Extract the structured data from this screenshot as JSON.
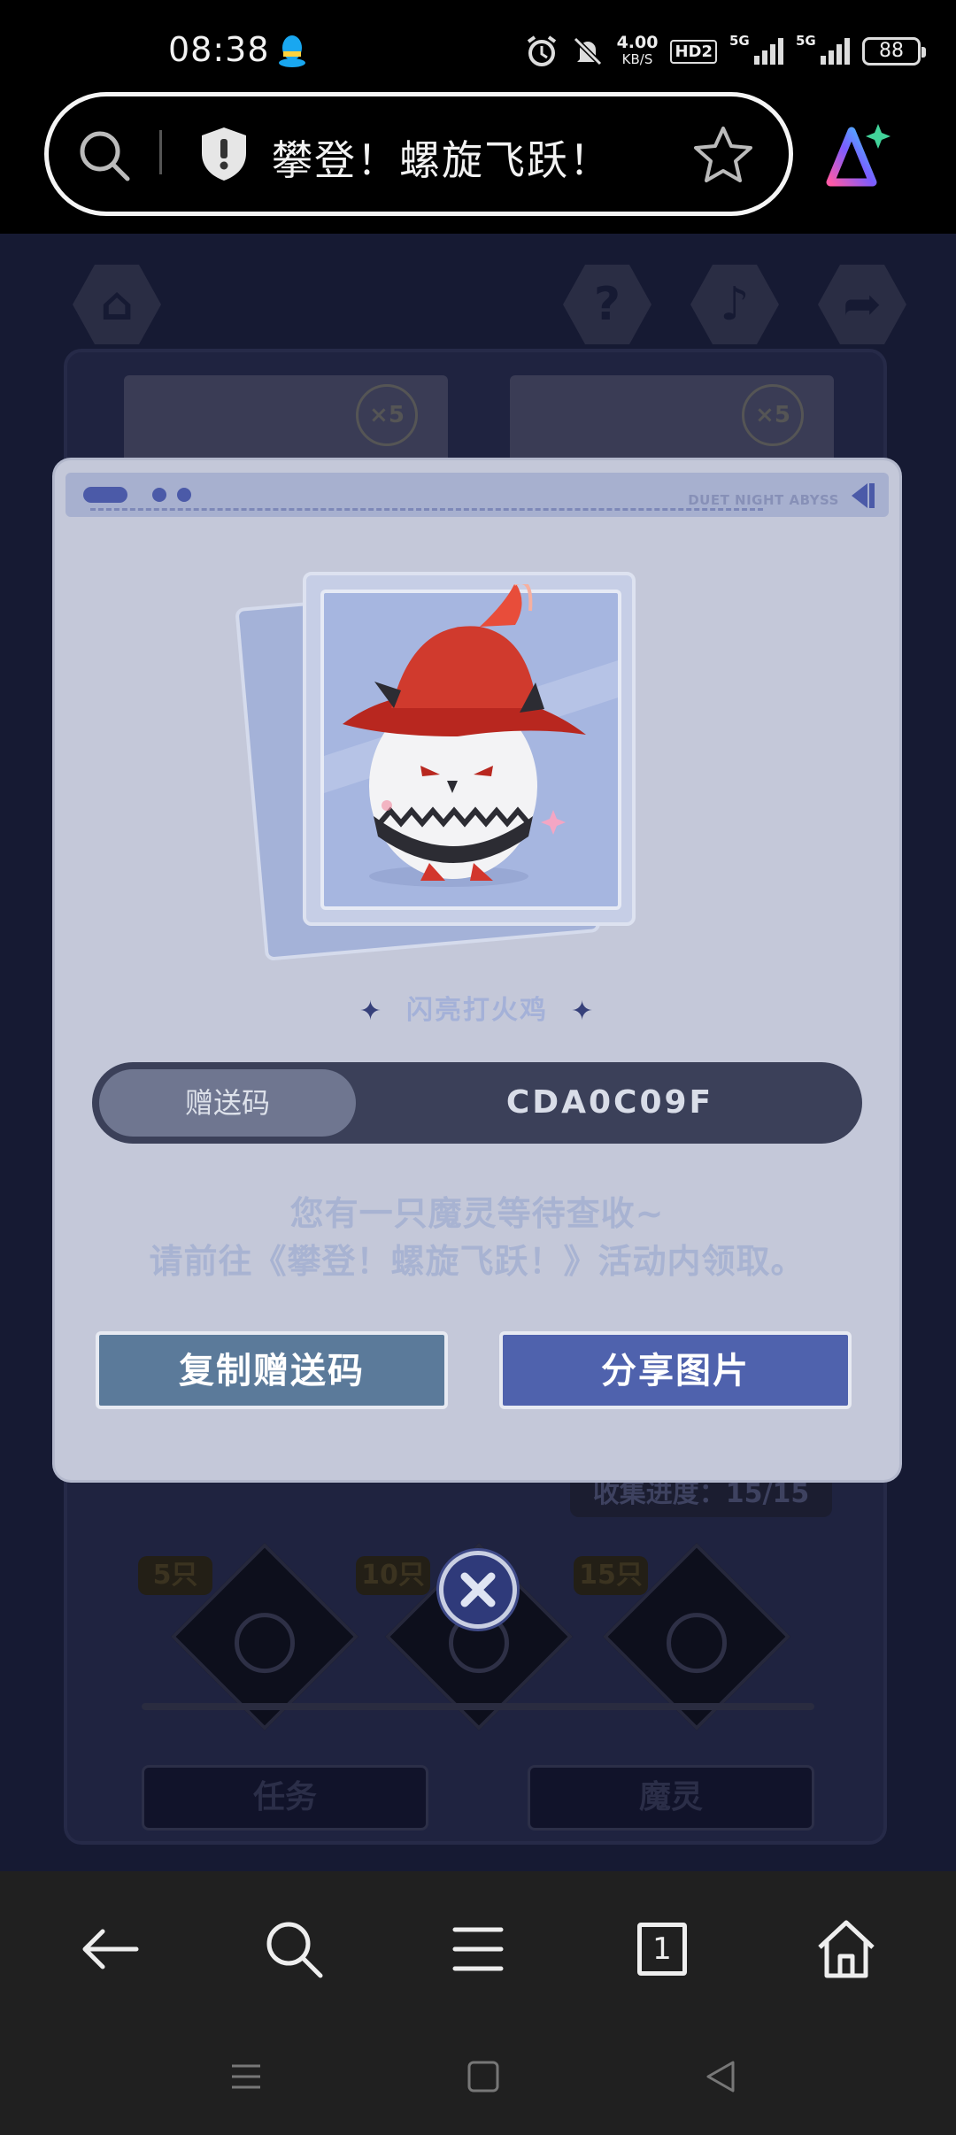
{
  "status_bar": {
    "time": "08:38",
    "net_speed_value": "4.00",
    "net_speed_unit": "KB/S",
    "hd_label": "HD2",
    "sim1_label": "5G",
    "sim2_label": "5G",
    "battery": "88",
    "icons": [
      "qq-icon",
      "alarm-icon",
      "mute-icon"
    ]
  },
  "url_bar": {
    "title": "攀登！螺旋飞跃！",
    "icons": [
      "search-icon",
      "shield-icon",
      "star-icon",
      "ai-assistant-icon"
    ]
  },
  "background_game": {
    "top_icons": [
      "home-icon",
      "help-icon",
      "music-icon",
      "share-icon"
    ],
    "card_multiplier_1": "×5",
    "card_multiplier_2": "×5",
    "progress_text": "收集进度：15/15",
    "tiers": [
      "5只",
      "10只",
      "15只"
    ],
    "tab_task": "任务",
    "tab_pet": "魔灵"
  },
  "dialog": {
    "brand": "DUET NIGHT ABYSS",
    "pet_name": "闪亮打火鸡",
    "code_label": "赠送码",
    "code_value": "CDA0C09F",
    "message_line1": "您有一只魔灵等待查收~",
    "message_line2": "请前往《攀登！螺旋飞跃！》活动内领取。",
    "copy_button": "复制赠送码",
    "share_button": "分享图片"
  },
  "browser_nav": {
    "tab_count": "1",
    "icons": [
      "back-icon",
      "search-icon",
      "menu-icon",
      "tabs-icon",
      "home-icon"
    ]
  },
  "system_nav": {
    "icons": [
      "recents-icon",
      "home-square-icon",
      "back-triangle-icon"
    ]
  },
  "colors": {
    "dialog_bg": "#c4c8d9",
    "copy_button": "#5b7a9a",
    "share_button": "#4f62ad",
    "code_bar": "#3b4059"
  }
}
